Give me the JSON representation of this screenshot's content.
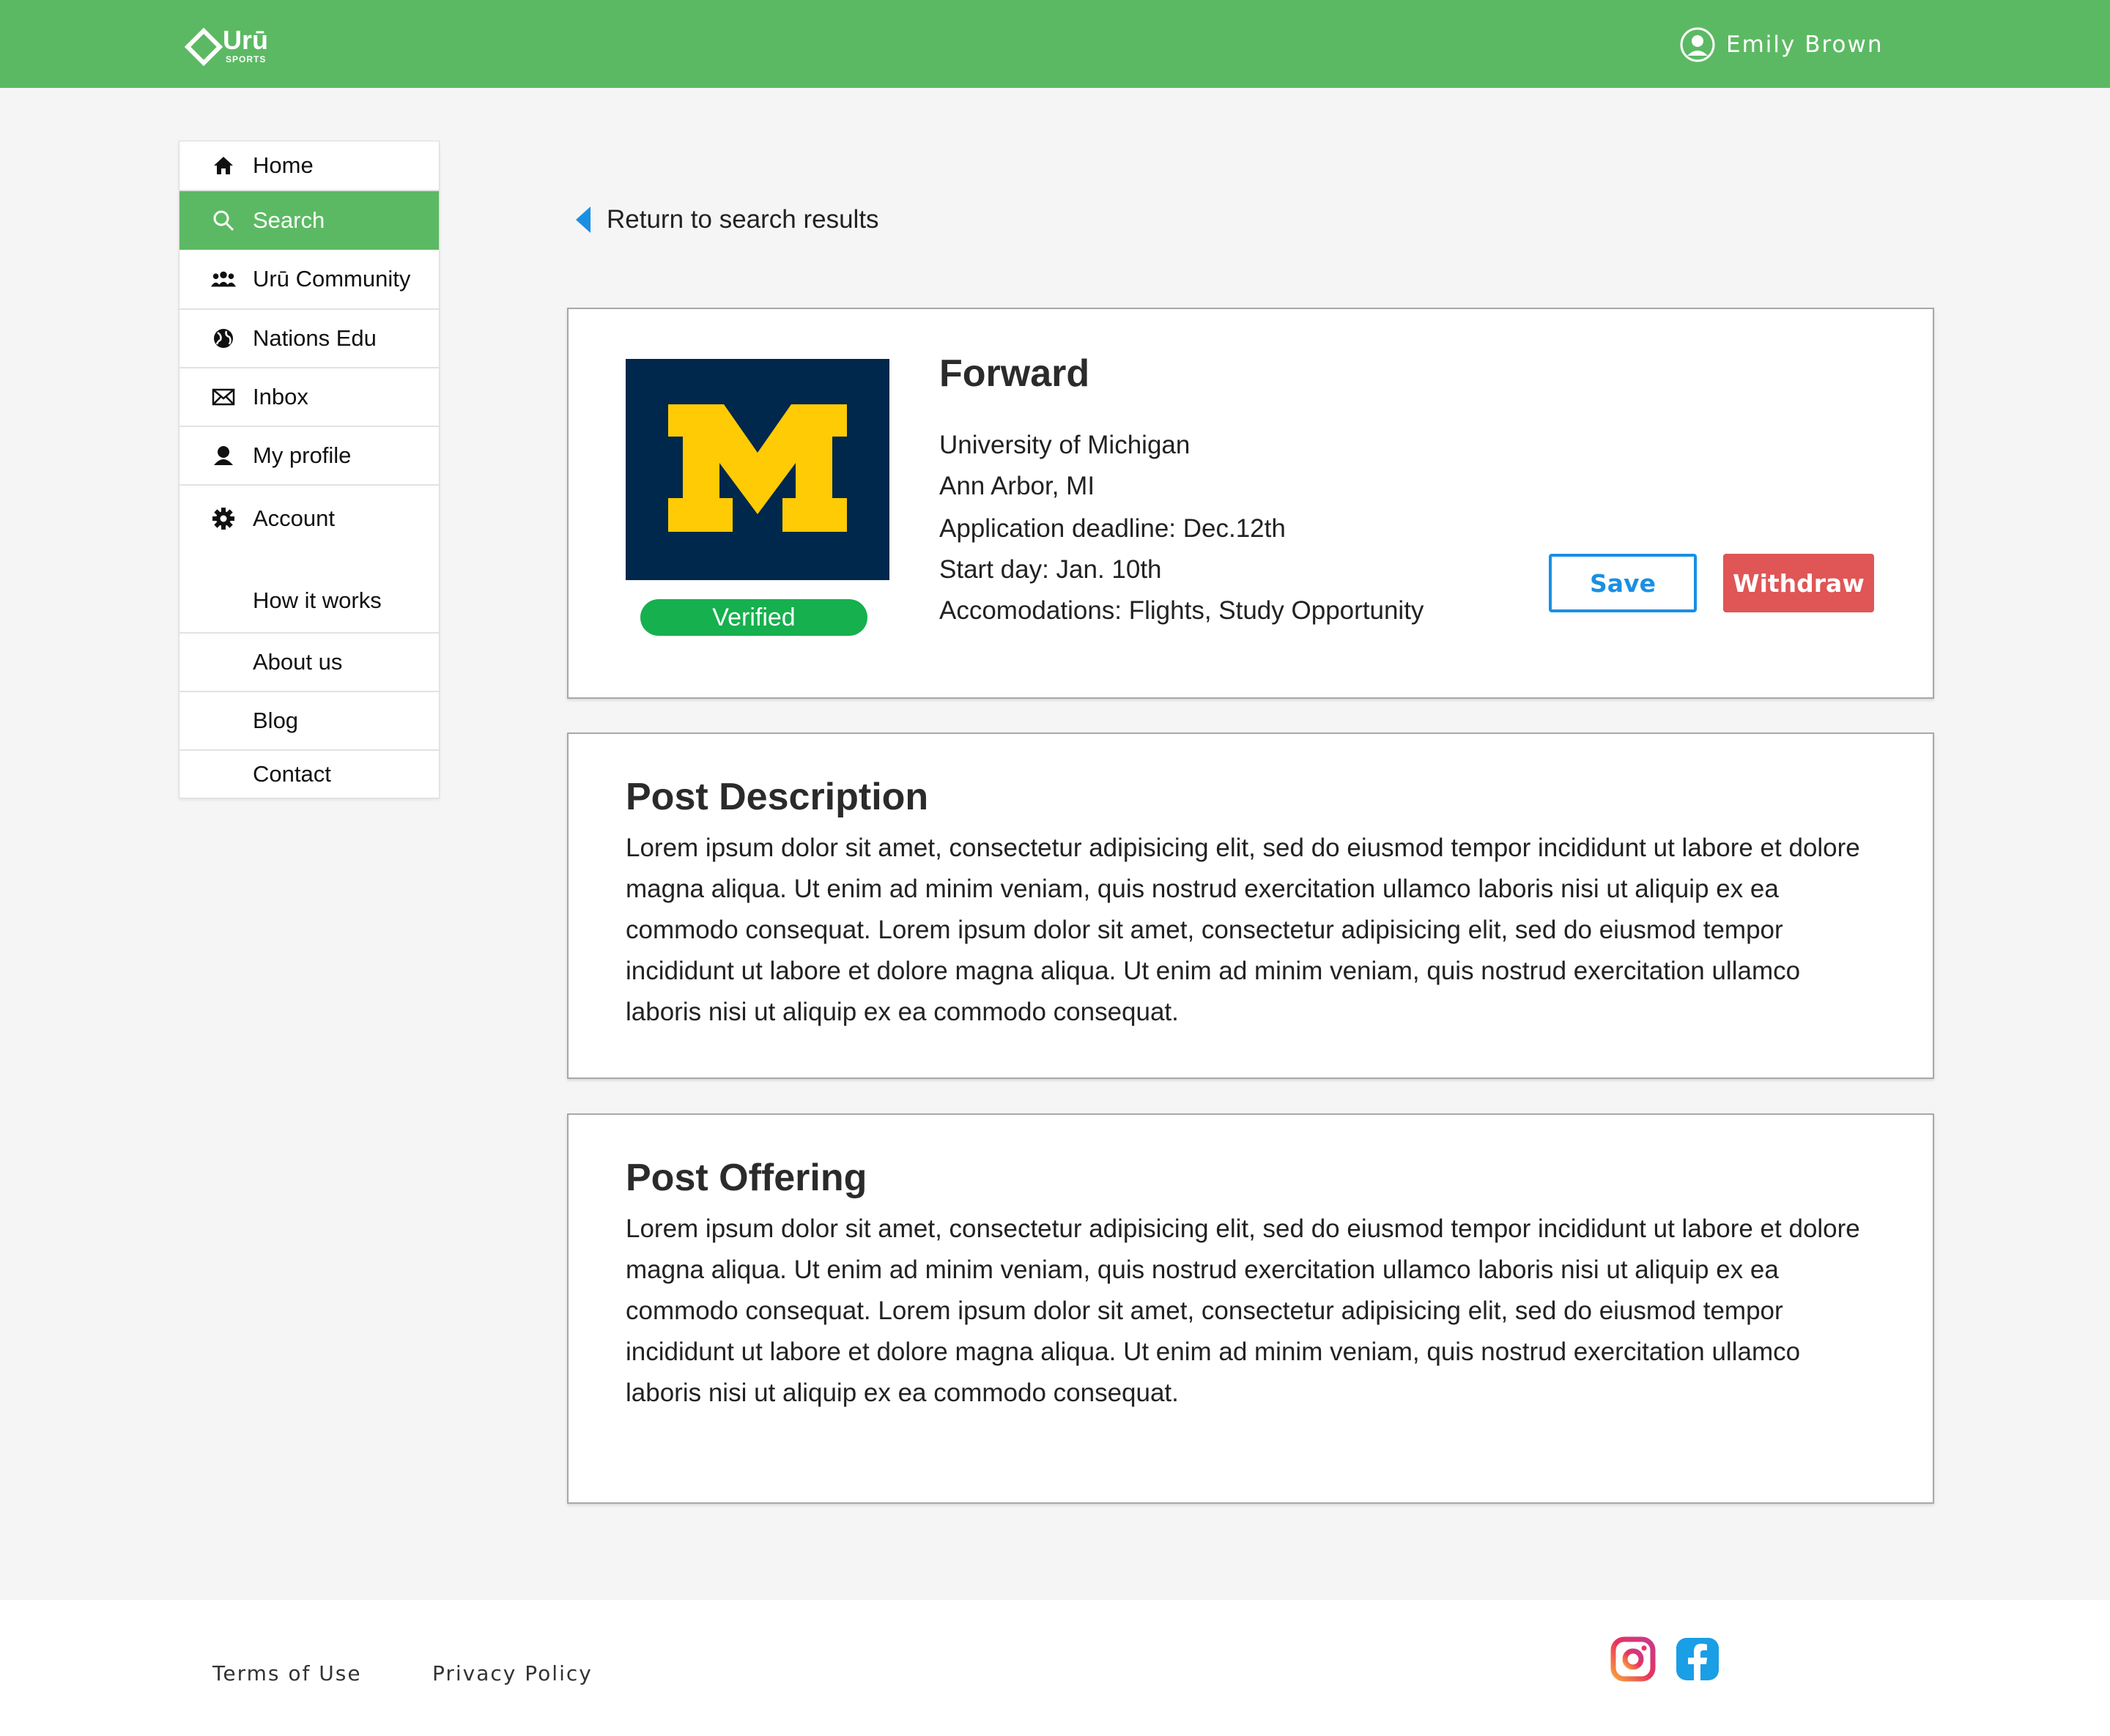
{
  "header": {
    "logo_text": "Urū",
    "logo_sub": "SPORTS",
    "user_name": "Emily Brown"
  },
  "sidebar": {
    "items": [
      {
        "label": "Home",
        "icon": "home-icon"
      },
      {
        "label": "Search",
        "icon": "search-icon",
        "active": true
      },
      {
        "label": "Urū Community",
        "icon": "community-icon"
      },
      {
        "label": "Nations Edu",
        "icon": "globe-icon"
      },
      {
        "label": "Inbox",
        "icon": "mail-icon"
      },
      {
        "label": "My profile",
        "icon": "user-icon"
      },
      {
        "label": "Account",
        "icon": "gear-icon"
      },
      {
        "label": "How it works"
      },
      {
        "label": "About us"
      },
      {
        "label": "Blog"
      },
      {
        "label": "Contact"
      }
    ]
  },
  "back_link": "Return to search results",
  "post": {
    "title": "Forward",
    "school": "University of Michigan",
    "location": "Ann Arbor, MI",
    "deadline": "Application deadline: Dec.12th",
    "start": "Start day: Jan. 10th",
    "accommodations": "Accomodations: Flights, Study Opportunity",
    "verified_label": "Verified",
    "save_label": "Save",
    "withdraw_label": "Withdraw",
    "colors": {
      "logo_bg": "#00274c",
      "logo_fg": "#ffcb05",
      "verified": "#16b04e",
      "save": "#1a8fe3",
      "withdraw": "#e05555"
    }
  },
  "description": {
    "title": "Post Description",
    "body": "Lorem ipsum dolor sit amet, consectetur adipisicing elit, sed do eiusmod tempor incididunt ut labore et dolore magna aliqua. Ut enim ad minim veniam, quis nostrud exercitation ullamco laboris nisi ut aliquip ex ea commodo consequat. Lorem ipsum dolor sit amet, consectetur adipisicing elit, sed do eiusmod tempor incididunt ut labore et dolore magna aliqua. Ut enim ad minim veniam, quis nostrud exercitation ullamco laboris nisi ut aliquip ex ea commodo consequat."
  },
  "offering": {
    "title": "Post Offering",
    "body": "Lorem ipsum dolor sit amet, consectetur adipisicing elit, sed do eiusmod tempor incididunt ut labore et dolore magna aliqua. Ut enim ad minim veniam, quis nostrud exercitation ullamco laboris nisi ut aliquip ex ea commodo consequat. Lorem ipsum dolor sit amet, consectetur adipisicing elit, sed do eiusmod tempor incididunt ut labore et dolore magna aliqua. Ut enim ad minim veniam, quis nostrud exercitation ullamco laboris nisi ut aliquip ex ea commodo consequat."
  },
  "footer": {
    "terms": "Terms of Use",
    "privacy": "Privacy Policy",
    "social": [
      "instagram-icon",
      "facebook-icon"
    ]
  },
  "theme": {
    "primary": "#5cb963",
    "background": "#f5f5f5"
  }
}
